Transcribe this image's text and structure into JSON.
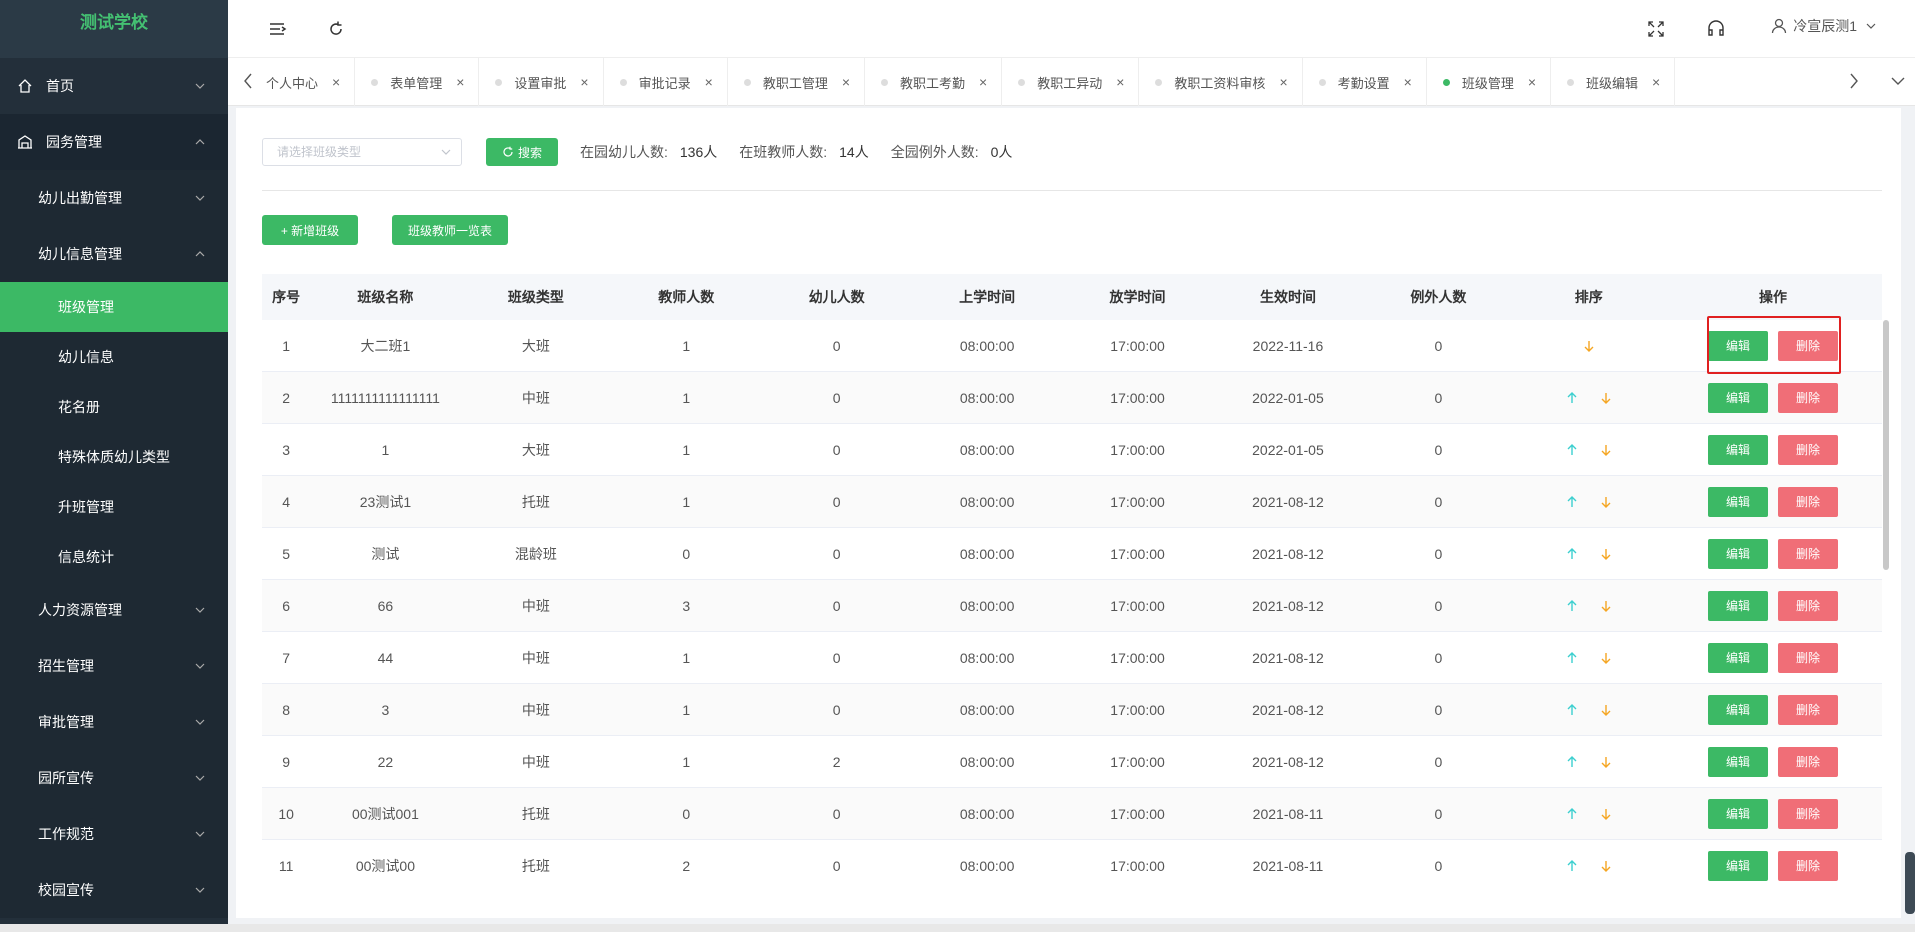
{
  "app": {
    "logo": "测试学校"
  },
  "sidebar": {
    "items": [
      {
        "label": "首页",
        "icon": "home-icon"
      },
      {
        "label": "园务管理",
        "icon": "building-icon"
      },
      {
        "label": "幼儿出勤管理"
      },
      {
        "label": "幼儿信息管理"
      },
      {
        "label": "班级管理"
      },
      {
        "label": "幼儿信息"
      },
      {
        "label": "花名册"
      },
      {
        "label": "特殊体质幼儿类型"
      },
      {
        "label": "升班管理"
      },
      {
        "label": "信息统计"
      },
      {
        "label": "人力资源管理"
      },
      {
        "label": "招生管理"
      },
      {
        "label": "审批管理"
      },
      {
        "label": "园所宣传"
      },
      {
        "label": "工作规范"
      },
      {
        "label": "校园宣传"
      }
    ]
  },
  "header": {
    "user": "冷宣辰测1"
  },
  "tabs": [
    {
      "label": "个人中心"
    },
    {
      "label": "表单管理"
    },
    {
      "label": "设置审批"
    },
    {
      "label": "审批记录"
    },
    {
      "label": "教职工管理"
    },
    {
      "label": "教职工考勤"
    },
    {
      "label": "教职工异动"
    },
    {
      "label": "教职工资料审核"
    },
    {
      "label": "考勤设置"
    },
    {
      "label": "班级管理"
    },
    {
      "label": "班级编辑"
    }
  ],
  "search": {
    "placeholder": "请选择班级类型",
    "button": "搜索",
    "stats": [
      {
        "label": "在园幼儿人数:",
        "value": "136人"
      },
      {
        "label": "在班教师人数:",
        "value": "14人"
      },
      {
        "label": "全园例外人数:",
        "value": "0人"
      }
    ]
  },
  "actions": {
    "add_class": "+ 新增班级",
    "teacher_list": "班级教师一览表"
  },
  "table": {
    "headers": [
      "序号",
      "班级名称",
      "班级类型",
      "教师人数",
      "幼儿人数",
      "上学时间",
      "放学时间",
      "生效时间",
      "例外人数",
      "排序",
      "操作"
    ],
    "edit_label": "编辑",
    "delete_label": "删除",
    "rows": [
      {
        "no": "1",
        "name": "大二班1",
        "type": "大班",
        "teachers": "1",
        "children": "0",
        "start": "08:00:00",
        "end": "17:00:00",
        "effective": "2022-11-16",
        "exceptions": "0"
      },
      {
        "no": "2",
        "name": "1111111111111111",
        "type": "中班",
        "teachers": "1",
        "children": "0",
        "start": "08:00:00",
        "end": "17:00:00",
        "effective": "2022-01-05",
        "exceptions": "0"
      },
      {
        "no": "3",
        "name": "1",
        "type": "大班",
        "teachers": "1",
        "children": "0",
        "start": "08:00:00",
        "end": "17:00:00",
        "effective": "2022-01-05",
        "exceptions": "0"
      },
      {
        "no": "4",
        "name": "23测试1",
        "type": "托班",
        "teachers": "1",
        "children": "0",
        "start": "08:00:00",
        "end": "17:00:00",
        "effective": "2021-08-12",
        "exceptions": "0"
      },
      {
        "no": "5",
        "name": "测试",
        "type": "混龄班",
        "teachers": "0",
        "children": "0",
        "start": "08:00:00",
        "end": "17:00:00",
        "effective": "2021-08-12",
        "exceptions": "0"
      },
      {
        "no": "6",
        "name": "66",
        "type": "中班",
        "teachers": "3",
        "children": "0",
        "start": "08:00:00",
        "end": "17:00:00",
        "effective": "2021-08-12",
        "exceptions": "0"
      },
      {
        "no": "7",
        "name": "44",
        "type": "中班",
        "teachers": "1",
        "children": "0",
        "start": "08:00:00",
        "end": "17:00:00",
        "effective": "2021-08-12",
        "exceptions": "0"
      },
      {
        "no": "8",
        "name": "3",
        "type": "中班",
        "teachers": "1",
        "children": "0",
        "start": "08:00:00",
        "end": "17:00:00",
        "effective": "2021-08-12",
        "exceptions": "0"
      },
      {
        "no": "9",
        "name": "22",
        "type": "中班",
        "teachers": "1",
        "children": "2",
        "start": "08:00:00",
        "end": "17:00:00",
        "effective": "2021-08-12",
        "exceptions": "0"
      },
      {
        "no": "10",
        "name": "00测试001",
        "type": "托班",
        "teachers": "0",
        "children": "0",
        "start": "08:00:00",
        "end": "17:00:00",
        "effective": "2021-08-11",
        "exceptions": "0"
      },
      {
        "no": "11",
        "name": "00测试00",
        "type": "托班",
        "teachers": "2",
        "children": "0",
        "start": "08:00:00",
        "end": "17:00:00",
        "effective": "2021-08-11",
        "exceptions": "0"
      }
    ]
  },
  "colors": {
    "primary": "#3cb965",
    "danger": "#f06e77",
    "sidebar": "#232f3a",
    "up_arrow": "#3ccfcf",
    "down_arrow": "#f5a623"
  }
}
